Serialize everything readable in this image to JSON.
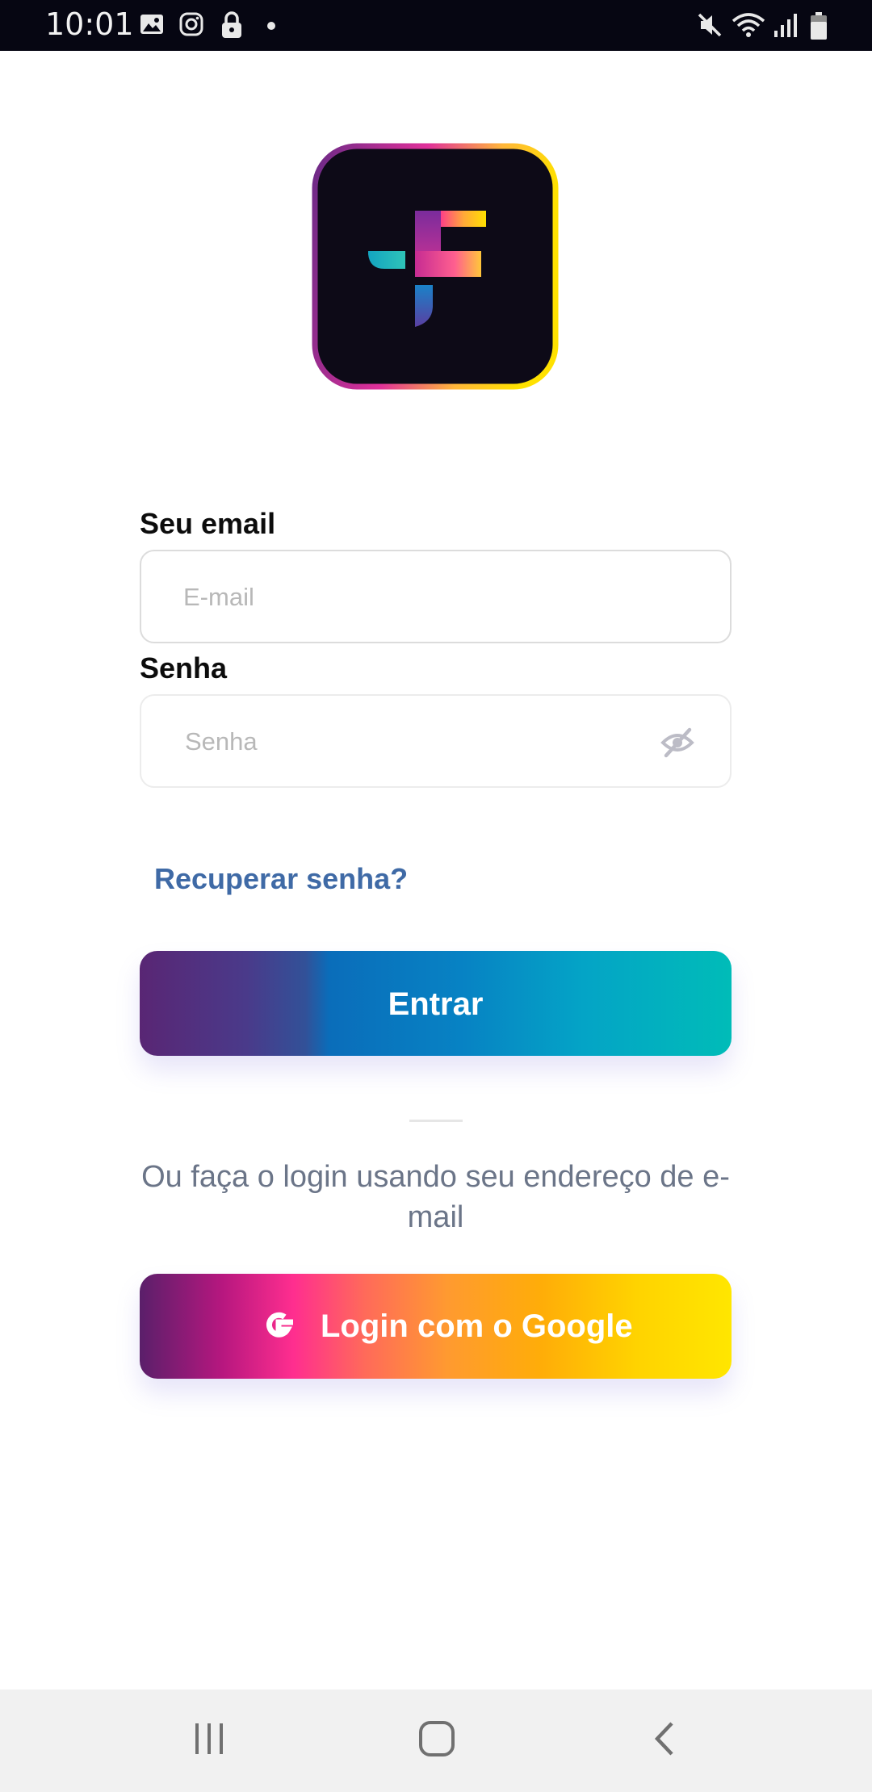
{
  "status_bar": {
    "time": "10:01",
    "left_icons": [
      "gallery-icon",
      "instagram-icon",
      "lock-icon",
      "youtube-icon",
      "dot-icon"
    ],
    "right_icons": [
      "mute-icon",
      "wifi-icon",
      "signal-icon",
      "battery-icon"
    ]
  },
  "app": {
    "logo_icon": "app-logo-icon"
  },
  "form": {
    "email_label": "Seu email",
    "email_placeholder": "E-mail",
    "password_label": "Senha",
    "password_placeholder": "Senha",
    "password_toggle_icon": "eye-off-icon",
    "recover_link": "Recuperar senha?",
    "submit_label": "Entrar"
  },
  "alt_login": {
    "or_text": "Ou faça o login usando seu endereço de e-mail",
    "google_label": "Login com o Google",
    "google_icon": "google-g-icon"
  },
  "nav_bar": {
    "icons": [
      "recent-apps-icon",
      "home-icon",
      "back-icon"
    ]
  },
  "colors": {
    "link": "#3f6aa6",
    "status_bar_bg": "#060612",
    "nav_bar_bg": "#f1f1f1",
    "enter_gradient_start": "#592674",
    "enter_gradient_end": "#00bcb8",
    "google_gradient_start": "#5a1f6a",
    "google_gradient_end": "#ffe600"
  }
}
